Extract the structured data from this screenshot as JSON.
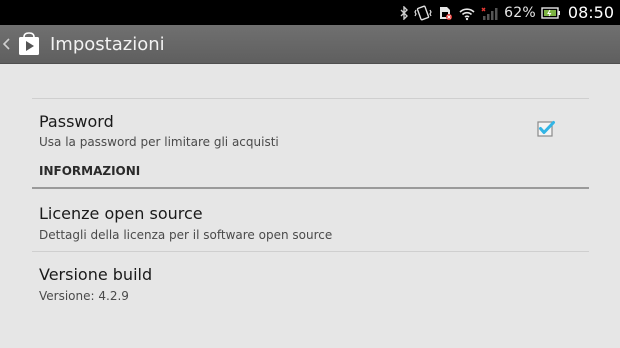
{
  "status_bar": {
    "battery_percent": "62%",
    "time": "08:50",
    "icons": [
      "bluetooth-icon",
      "vibrate-icon",
      "no-sim-icon",
      "wifi-icon",
      "signal-icon",
      "battery-icon"
    ]
  },
  "action_bar": {
    "title": "Impostazioni",
    "app_icon": "play-store-icon"
  },
  "preferences": {
    "password": {
      "title": "Password",
      "summary": "Usa la password per limitare gli acquisti",
      "checked": true
    },
    "section_header": "INFORMAZIONI",
    "licenses": {
      "title": "Licenze open source",
      "summary": "Dettagli della licenza per il software open source"
    },
    "build": {
      "title": "Versione build",
      "summary": "Versione: 4.2.9"
    }
  },
  "colors": {
    "accent_check": "#33b5e5",
    "background": "#e6e6e6",
    "action_bar": "#666666"
  }
}
